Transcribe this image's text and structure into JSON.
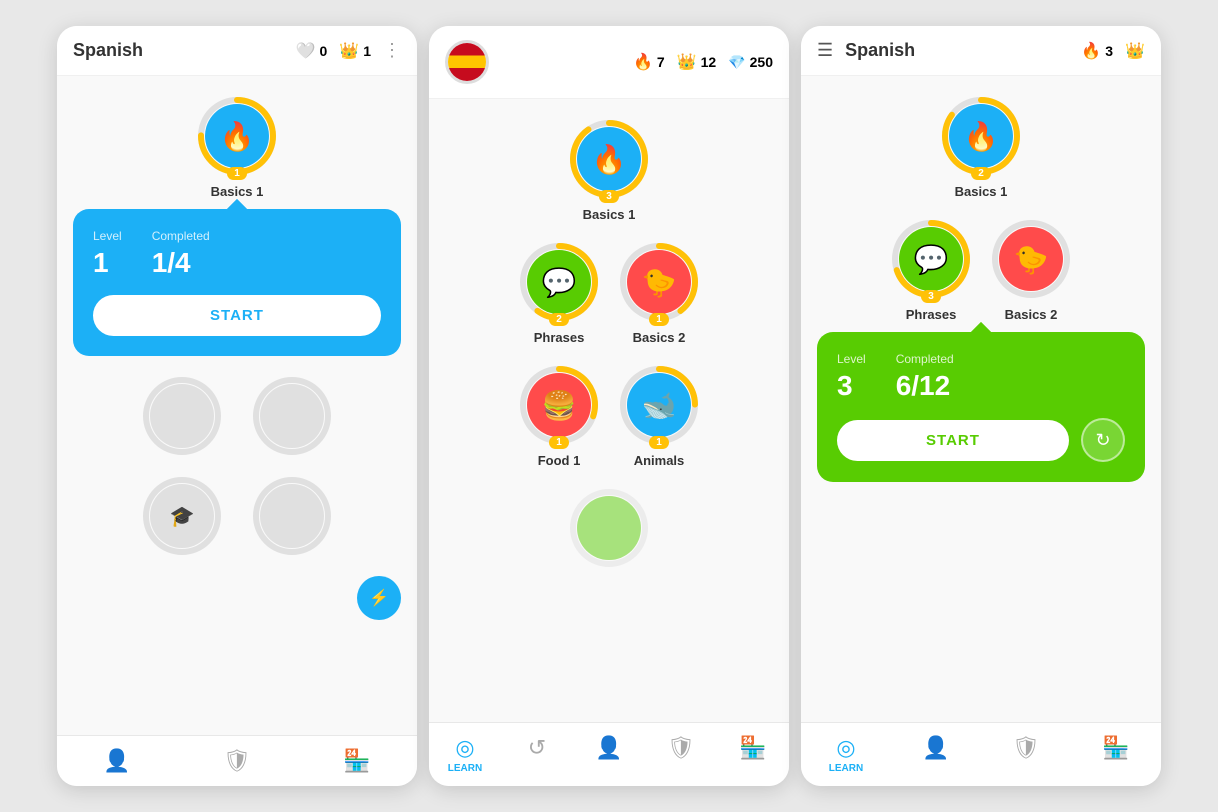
{
  "screens": [
    {
      "id": "screen1",
      "header": {
        "title": "Spanish",
        "show_title": true,
        "show_flag": false,
        "show_menu": false,
        "show_dots": true,
        "hearts": "0",
        "crowns": "1",
        "gems": null
      },
      "skills": [
        {
          "id": "basics1_s1",
          "label": "Basics 1",
          "color": "blue",
          "icon": "🔥",
          "badge": "1",
          "progress": 75,
          "locked": false
        }
      ],
      "locked_row1": 2,
      "locked_row2": 2,
      "popup": {
        "type": "blue",
        "level_label": "Level",
        "level_value": "1",
        "completed_label": "Completed",
        "completed_value": "1/4",
        "start_label": "START",
        "btn_color": "blue"
      },
      "nav": [
        {
          "icon": "👤",
          "active": false,
          "label": null
        },
        {
          "icon": "🛡",
          "active": false,
          "label": null
        },
        {
          "icon": "🏪",
          "active": false,
          "label": null
        }
      ]
    },
    {
      "id": "screen2",
      "header": {
        "title": null,
        "show_title": false,
        "show_flag": true,
        "show_menu": false,
        "show_dots": false,
        "hearts": "7",
        "crowns": "12",
        "gems": "250"
      },
      "skills_center": [
        {
          "id": "basics1_s2",
          "label": "Basics 1",
          "color": "blue",
          "icon": "🔥",
          "badge": "3",
          "progress": 90,
          "locked": false
        }
      ],
      "skills_row1": [
        {
          "id": "phrases_s2",
          "label": "Phrases",
          "color": "green",
          "icon": "💬",
          "badge": "2",
          "progress": 60,
          "locked": false
        },
        {
          "id": "basics2_s2",
          "label": "Basics 2",
          "color": "red",
          "icon": "🐤",
          "badge": "1",
          "progress": 40,
          "locked": false
        }
      ],
      "skills_row2": [
        {
          "id": "food1_s2",
          "label": "Food 1",
          "color": "red",
          "icon": "🍔",
          "badge": "1",
          "progress": 30,
          "locked": false
        },
        {
          "id": "animals_s2",
          "label": "Animals",
          "color": "teal",
          "icon": "🐋",
          "badge": "1",
          "progress": 25,
          "locked": false
        }
      ],
      "popup": null,
      "nav": [
        {
          "icon": "⊕",
          "active": true,
          "label": "LEARN",
          "unicode": "learn"
        },
        {
          "icon": "↺",
          "active": false,
          "label": null
        },
        {
          "icon": "👤",
          "active": false,
          "label": null
        },
        {
          "icon": "🛡",
          "active": false,
          "label": null
        },
        {
          "icon": "🏪",
          "active": false,
          "label": null
        }
      ]
    },
    {
      "id": "screen3",
      "header": {
        "title": "Spanish",
        "show_title": true,
        "show_flag": false,
        "show_menu": true,
        "show_dots": false,
        "hearts": "3",
        "crowns": null,
        "gems": null
      },
      "skills_center": [
        {
          "id": "basics1_s3",
          "label": "Basics 1",
          "color": "blue",
          "icon": "🔥",
          "badge": "2",
          "progress": 85,
          "locked": false
        }
      ],
      "skills_row1": [
        {
          "id": "phrases_s3",
          "label": "Phrases",
          "color": "green",
          "icon": "💬",
          "badge": "3",
          "progress": 70,
          "locked": false
        },
        {
          "id": "basics2_s3",
          "label": "Basics 2",
          "color": "red",
          "icon": "🐤",
          "badge": null,
          "progress": 0,
          "locked": false
        }
      ],
      "popup": {
        "type": "green",
        "level_label": "Level",
        "level_value": "3",
        "completed_label": "Completed",
        "completed_value": "6/12",
        "start_label": "START",
        "btn_color": "green"
      },
      "nav": [
        {
          "icon": "learn",
          "active": true,
          "label": "Learn"
        },
        {
          "icon": "👤",
          "active": false,
          "label": null
        },
        {
          "icon": "🛡",
          "active": false,
          "label": null
        },
        {
          "icon": "🏪",
          "active": false,
          "label": null
        }
      ]
    }
  ],
  "colors": {
    "blue": "#1cb0f6",
    "green": "#58cc02",
    "red": "#ff4b4b",
    "gold": "#ffc107",
    "gray": "#e0e0e0",
    "text_dark": "#333333",
    "popup_blue": "#1cb0f6",
    "popup_green": "#58cc02"
  }
}
